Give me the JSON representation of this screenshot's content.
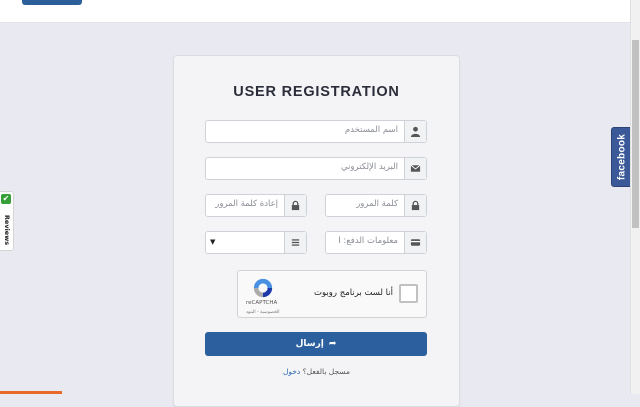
{
  "form": {
    "title": "USER REGISTRATION",
    "username_placeholder": "اسم المستخدم",
    "email_placeholder": "البريد الإلكتروني",
    "password_placeholder": "كلمة المرور",
    "confirm_password_placeholder": "إعادة كلمة المرور",
    "payment_placeholder": "معلومات الدفع: I",
    "select_value": "",
    "captcha_label": "أنا لست برنامج روبوت",
    "captcha_brand": "reCAPTCHA",
    "captcha_links": "الخصوصية - البنود",
    "submit_label": "إرسال",
    "login_prompt": "مسجل بالفعل؟",
    "login_link": "دخول"
  },
  "side_tabs": {
    "facebook": "facebook",
    "reviews": "Reviews"
  },
  "icons": {
    "user": "user-icon",
    "email": "envelope-icon",
    "password": "lock-icon",
    "payment": "credit-card-icon",
    "select": "list-icon",
    "submit": "share-arrow-icon"
  },
  "colors": {
    "primary": "#2b5f9e",
    "facebook": "#3b5998",
    "reviews_check": "#36a038",
    "background": "#e9eaf1"
  }
}
